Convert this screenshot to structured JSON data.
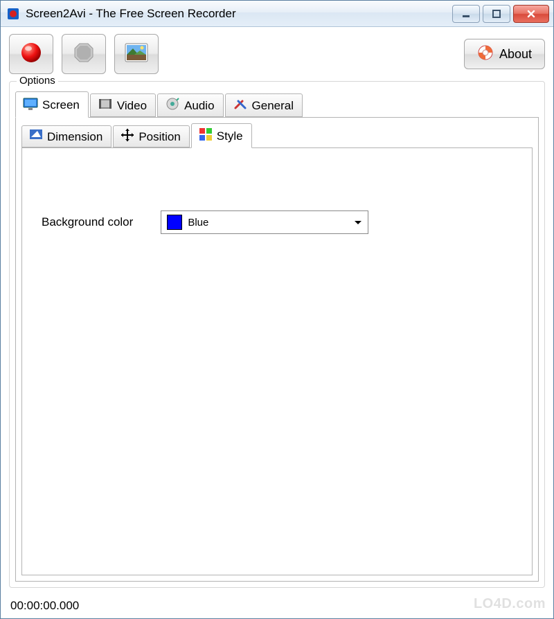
{
  "window": {
    "title": "Screen2Avi - The Free Screen Recorder"
  },
  "toolbar": {
    "about_label": "About"
  },
  "options": {
    "legend": "Options",
    "tabs": [
      {
        "label": "Screen"
      },
      {
        "label": "Video"
      },
      {
        "label": "Audio"
      },
      {
        "label": "General"
      }
    ],
    "subtabs": [
      {
        "label": "Dimension"
      },
      {
        "label": "Position"
      },
      {
        "label": "Style"
      }
    ],
    "style": {
      "bg_color_label": "Background color",
      "bg_color_value": "Blue",
      "bg_color_hex": "#0000ff"
    }
  },
  "status": {
    "time": "00:00:00.000"
  },
  "watermark": "LO4D.com"
}
